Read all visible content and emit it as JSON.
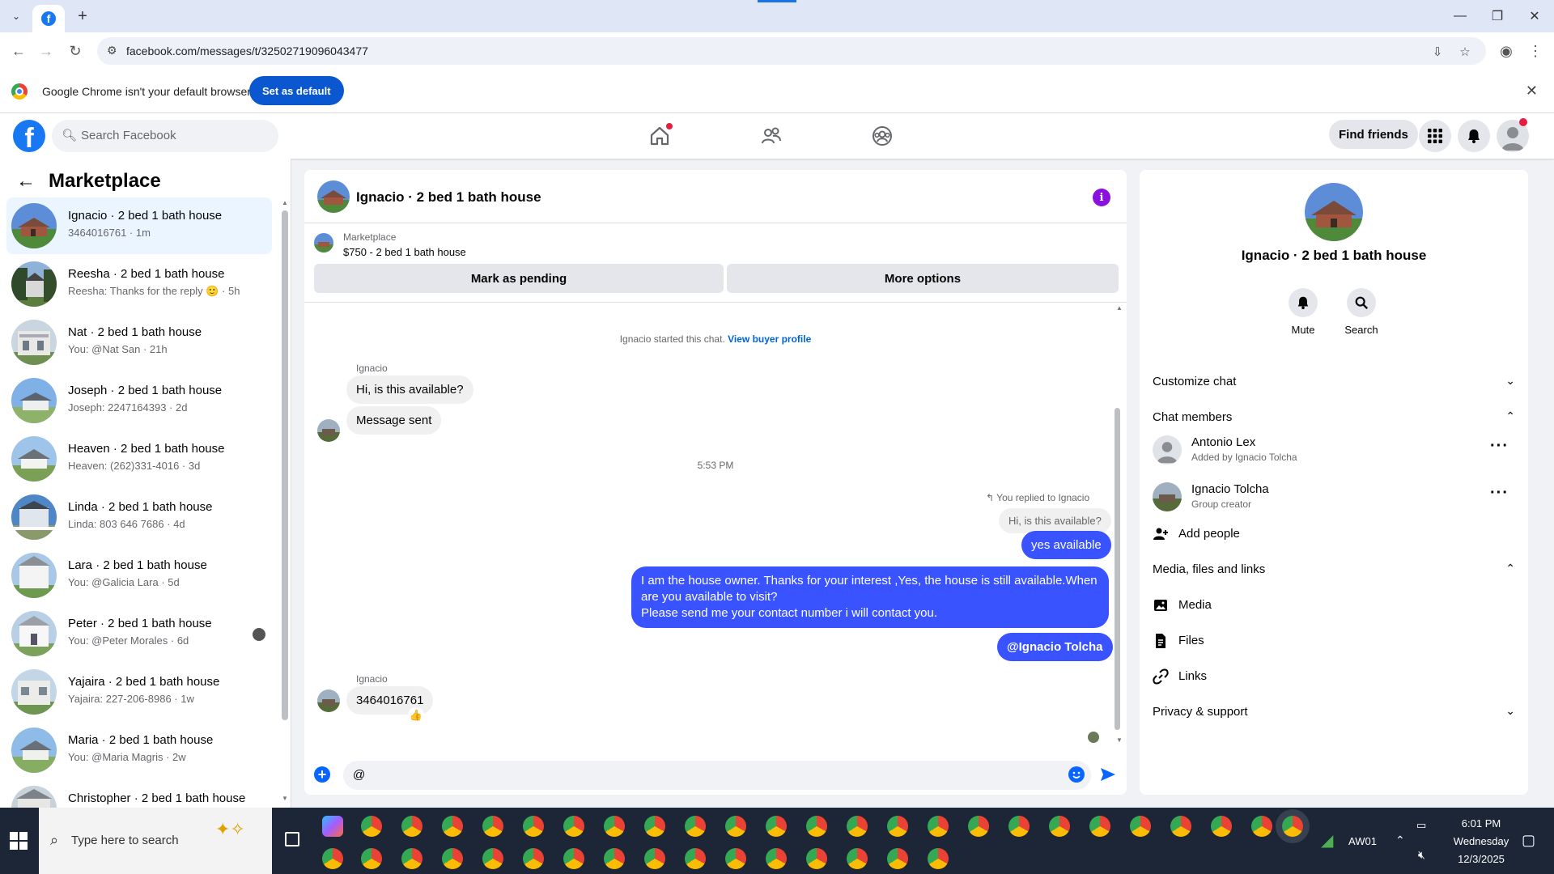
{
  "browser": {
    "url": "facebook.com/messages/t/32502719096043477",
    "infobar_message": "Google Chrome isn't your default browser",
    "set_default_label": "Set as default"
  },
  "fb_header": {
    "search_placeholder": "Search Facebook",
    "find_friends_label": "Find friends"
  },
  "sidebar": {
    "title": "Marketplace",
    "conversations": [
      {
        "name": "Ignacio · 2 bed 1 bath house",
        "preview": "3464016761 · 1m",
        "active": true
      },
      {
        "name": "Reesha · 2 bed 1 bath house",
        "preview": "Reesha: Thanks for the reply 🙂 · 5h"
      },
      {
        "name": "Nat · 2 bed 1 bath house",
        "preview": "You: @Nat San · 21h"
      },
      {
        "name": "Joseph · 2 bed 1 bath house",
        "preview": "Joseph: 2247164393 · 2d"
      },
      {
        "name": "Heaven · 2 bed 1 bath house",
        "preview": "Heaven: (262)331-4016 · 3d"
      },
      {
        "name": "Linda · 2 bed 1 bath house",
        "preview": "Linda: 803 646 7686 · 4d"
      },
      {
        "name": "Lara · 2 bed 1 bath house",
        "preview": "You: @Galicia Lara · 5d"
      },
      {
        "name": "Peter · 2 bed 1 bath house",
        "preview": "You: @Peter Morales · 6d"
      },
      {
        "name": "Yajaira · 2 bed 1 bath house",
        "preview": "Yajaira: 227-206-8986 · 1w"
      },
      {
        "name": "Maria · 2 bed 1 bath house",
        "preview": "You: @Maria Magris · 2w"
      },
      {
        "name": "Christopher · 2 bed 1 bath house",
        "preview": ""
      }
    ]
  },
  "chat": {
    "title": "Ignacio · 2 bed 1 bath house",
    "listing_source": "Marketplace",
    "listing_price": "$750 - 2 bed 1 bath house",
    "mark_pending_label": "Mark as pending",
    "more_options_label": "More options",
    "started_text": "Ignacio started this chat.",
    "view_profile_link": "View buyer profile",
    "sender_name": "Ignacio",
    "msg_1": "Hi, is this available?",
    "msg_2": "Message sent",
    "timestamp": "5:53 PM",
    "reply_label": "You replied to Ignacio",
    "reply_quote": "Hi, is this available?",
    "out_1": "yes available",
    "out_2_line1": "I am the house owner. Thanks for your interest ,Yes, the house is still available.When are you available to visit?",
    "out_2_line2": "Please send me your contact number i will contact you.",
    "out_3": "@Ignacio Tolcha",
    "sender_name_2": "Ignacio",
    "msg_3": "3464016761",
    "reaction": "👍",
    "composer_value": "@"
  },
  "right_panel": {
    "name": "Ignacio · 2 bed 1 bath house",
    "mute_label": "Mute",
    "search_label": "Search",
    "customize_chat": "Customize chat",
    "chat_members": "Chat members",
    "members": [
      {
        "name": "Antonio Lex",
        "sub": "Added by Ignacio Tolcha"
      },
      {
        "name": "Ignacio Tolcha",
        "sub": "Group creator"
      }
    ],
    "add_people": "Add people",
    "media_section": "Media, files and links",
    "media": "Media",
    "files": "Files",
    "links": "Links",
    "privacy": "Privacy & support"
  },
  "taskbar": {
    "search_placeholder": "Type here to search",
    "network_label": "AW01",
    "time": "6:01 PM",
    "day": "Wednesday",
    "date": "12/3/2025"
  },
  "colors": {
    "fb_blue": "#1877f2",
    "messenger_blue": "#3853ff",
    "chrome_button": "#0b57d0"
  }
}
